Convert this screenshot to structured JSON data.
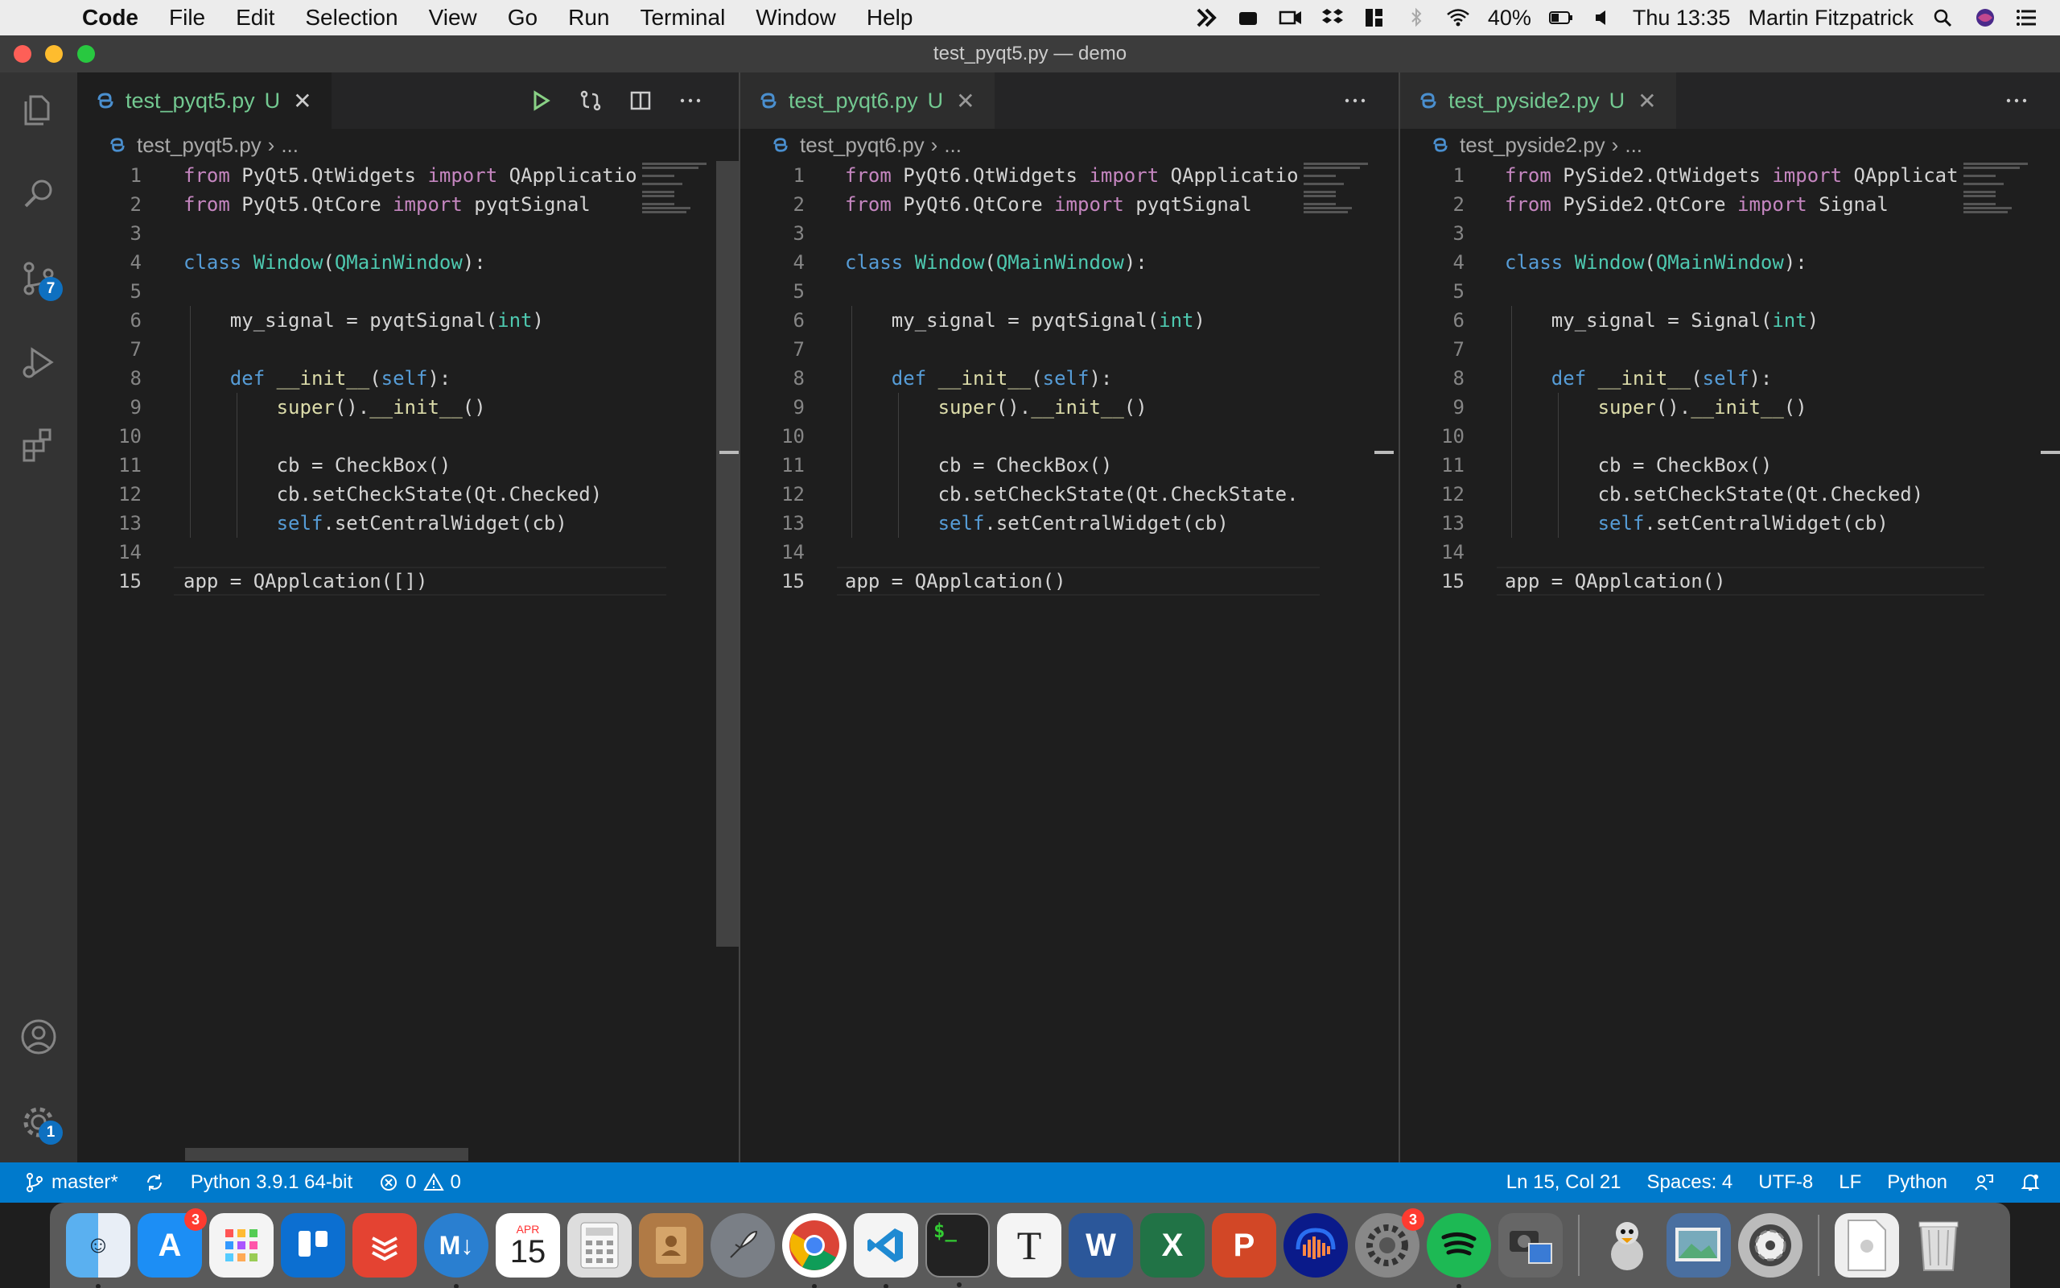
{
  "menubar": {
    "app": "Code",
    "items": [
      "File",
      "Edit",
      "Selection",
      "View",
      "Go",
      "Run",
      "Terminal",
      "Window",
      "Help"
    ],
    "battery": "40%",
    "clock": "Thu 13:35",
    "user": "Martin Fitzpatrick"
  },
  "window": {
    "title": "test_pyqt5.py — demo"
  },
  "activity": {
    "scm_badge": "7",
    "settings_badge": "1"
  },
  "groups": [
    {
      "tab_label": "test_pyqt5.py",
      "tab_status": "U",
      "breadcrumb_file": "test_pyqt5.py",
      "breadcrumb_more": "...",
      "lines": [
        "from PyQt5.QtWidgets import QApplicatio",
        "from PyQt5.QtCore import pyqtSignal",
        "",
        "class Window(QMainWindow):",
        "",
        "    my_signal = pyqtSignal(int)",
        "",
        "    def __init__(self):",
        "        super().__init__()",
        "",
        "        cb = CheckBox()",
        "        cb.setCheckState(Qt.Checked)",
        "        self.setCentralWidget(cb)",
        "",
        "app = QApplcation([])"
      ]
    },
    {
      "tab_label": "test_pyqt6.py",
      "tab_status": "U",
      "breadcrumb_file": "test_pyqt6.py",
      "breadcrumb_more": "...",
      "lines": [
        "from PyQt6.QtWidgets import QApplicatio",
        "from PyQt6.QtCore import pyqtSignal",
        "",
        "class Window(QMainWindow):",
        "",
        "    my_signal = pyqtSignal(int)",
        "",
        "    def __init__(self):",
        "        super().__init__()",
        "",
        "        cb = CheckBox()",
        "        cb.setCheckState(Qt.CheckState.",
        "        self.setCentralWidget(cb)",
        "",
        "app = QApplcation()"
      ]
    },
    {
      "tab_label": "test_pyside2.py",
      "tab_status": "U",
      "breadcrumb_file": "test_pyside2.py",
      "breadcrumb_more": "...",
      "lines": [
        "from PySide2.QtWidgets import QApplicat",
        "from PySide2.QtCore import Signal",
        "",
        "class Window(QMainWindow):",
        "",
        "    my_signal = Signal(int)",
        "",
        "    def __init__(self):",
        "        super().__init__()",
        "",
        "        cb = CheckBox()",
        "        cb.setCheckState(Qt.Checked)",
        "        self.setCentralWidget(cb)",
        "",
        "app = QApplcation()"
      ]
    }
  ],
  "line_numbers": [
    "1",
    "2",
    "3",
    "4",
    "5",
    "6",
    "7",
    "8",
    "9",
    "10",
    "11",
    "12",
    "13",
    "14",
    "15"
  ],
  "statusbar": {
    "branch": "master*",
    "interpreter": "Python 3.9.1 64-bit",
    "errors": "0",
    "warnings": "0",
    "position": "Ln 15, Col 21",
    "spaces": "Spaces: 4",
    "encoding": "UTF-8",
    "eol": "LF",
    "language": "Python"
  },
  "dock": {
    "appstore_badge": "3",
    "calendar_month": "APR",
    "calendar_day": "15",
    "settings_badge": "3"
  },
  "colors": {
    "statusbar": "#007acc",
    "tab_modified": "#73c991",
    "keyword": "#c586c0",
    "class": "#4ec9b0"
  }
}
